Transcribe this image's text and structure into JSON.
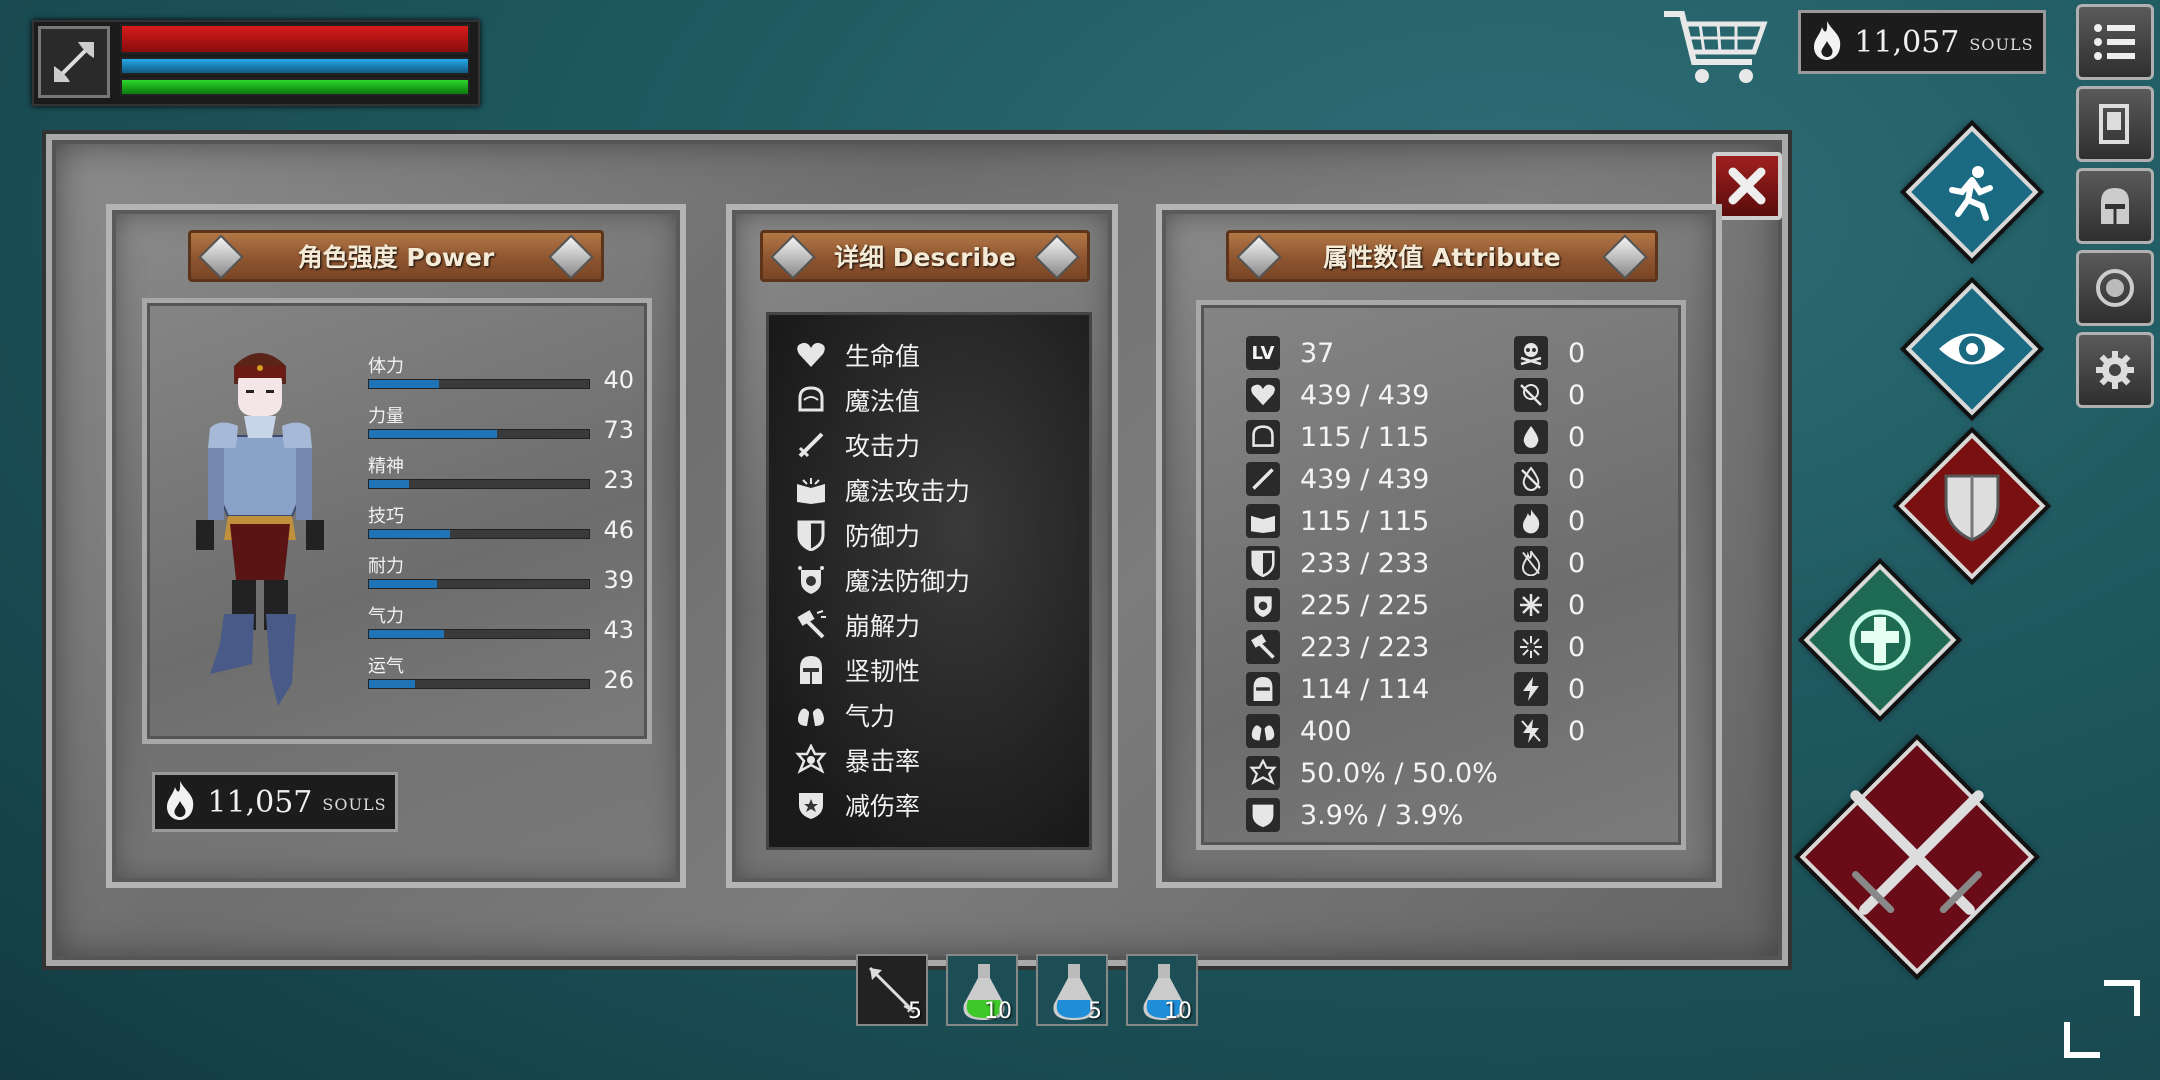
{
  "hud": {
    "player_icon": "battle-axe-icon",
    "hp_fraction": 1.0,
    "mp_fraction": 1.0,
    "stamina_fraction": 1.0,
    "souls_amount": "11,057",
    "souls_label": "SOULS"
  },
  "menu": [
    "list-menu-icon",
    "inventory-card-icon",
    "helmet-icon",
    "emblem-icon",
    "settings-gear-icon"
  ],
  "panels": {
    "power": {
      "title": "角色强度 Power",
      "stats": [
        {
          "name": "体力",
          "value": "40",
          "fraction": 0.32
        },
        {
          "name": "力量",
          "value": "73",
          "fraction": 0.58
        },
        {
          "name": "精神",
          "value": "23",
          "fraction": 0.18
        },
        {
          "name": "技巧",
          "value": "46",
          "fraction": 0.37
        },
        {
          "name": "耐力",
          "value": "39",
          "fraction": 0.31
        },
        {
          "name": "气力",
          "value": "43",
          "fraction": 0.34
        },
        {
          "name": "运气",
          "value": "26",
          "fraction": 0.21
        }
      ],
      "souls_amount": "11,057",
      "souls_label": "SOULS"
    },
    "describe": {
      "title": "详细 Describe",
      "items": [
        {
          "label": "生命值",
          "icon": "heart-icon"
        },
        {
          "label": "魔法值",
          "icon": "brain-icon"
        },
        {
          "label": "攻击力",
          "icon": "sword-icon"
        },
        {
          "label": "魔法攻击力",
          "icon": "spellbook-icon"
        },
        {
          "label": "防御力",
          "icon": "shield-icon"
        },
        {
          "label": "魔法防御力",
          "icon": "magic-shield-icon"
        },
        {
          "label": "崩解力",
          "icon": "hammer-break-icon"
        },
        {
          "label": "坚韧性",
          "icon": "helmet-icon"
        },
        {
          "label": "气力",
          "icon": "lungs-icon"
        },
        {
          "label": "暴击率",
          "icon": "critical-star-icon"
        },
        {
          "label": "减伤率",
          "icon": "damage-reduce-icon"
        }
      ]
    },
    "attribute": {
      "title": "属性数值 Attribute",
      "left": [
        {
          "icon": "level-icon",
          "badge": "LV",
          "value": "37"
        },
        {
          "icon": "heart-icon",
          "value": "439 / 439"
        },
        {
          "icon": "brain-icon",
          "value": "115 / 115"
        },
        {
          "icon": "sword-icon",
          "value": "439 / 439"
        },
        {
          "icon": "spellbook-icon",
          "value": "115 / 115"
        },
        {
          "icon": "shield-icon",
          "value": "233 / 233"
        },
        {
          "icon": "magic-shield-icon",
          "value": "225 / 225"
        },
        {
          "icon": "hammer-break-icon",
          "value": "223 / 223"
        },
        {
          "icon": "helmet-icon",
          "value": "114 / 114"
        },
        {
          "icon": "lungs-icon",
          "value": "400"
        },
        {
          "icon": "critical-star-icon",
          "value": "50.0% / 50.0%"
        },
        {
          "icon": "damage-reduce-icon",
          "value": "3.9% / 3.9%"
        }
      ],
      "right": [
        {
          "icon": "poison-skull-icon",
          "value": "0"
        },
        {
          "icon": "poison-resist-icon",
          "value": "0"
        },
        {
          "icon": "bleed-drop-icon",
          "value": "0"
        },
        {
          "icon": "bleed-resist-icon",
          "value": "0"
        },
        {
          "icon": "fire-icon",
          "value": "0"
        },
        {
          "icon": "fire-resist-icon",
          "value": "0"
        },
        {
          "icon": "frost-icon",
          "value": "0"
        },
        {
          "icon": "frost-resist-icon",
          "value": "0"
        },
        {
          "icon": "lightning-icon",
          "value": "0"
        },
        {
          "icon": "lightning-resist-icon",
          "value": "0"
        }
      ]
    }
  },
  "quickbar": [
    {
      "icon": "arrow-icon",
      "count": "5"
    },
    {
      "icon": "green-potion-icon",
      "count": "10"
    },
    {
      "icon": "blue-potion-icon",
      "count": "5"
    },
    {
      "icon": "blue-potion-icon",
      "count": "10"
    }
  ],
  "colors": {
    "hp": "#d61b1b",
    "mp": "#26a8e6",
    "stamina": "#2cd62c",
    "stat_fill": "#1f74b8",
    "plaque": "#8e5530",
    "close": "#a02020"
  }
}
